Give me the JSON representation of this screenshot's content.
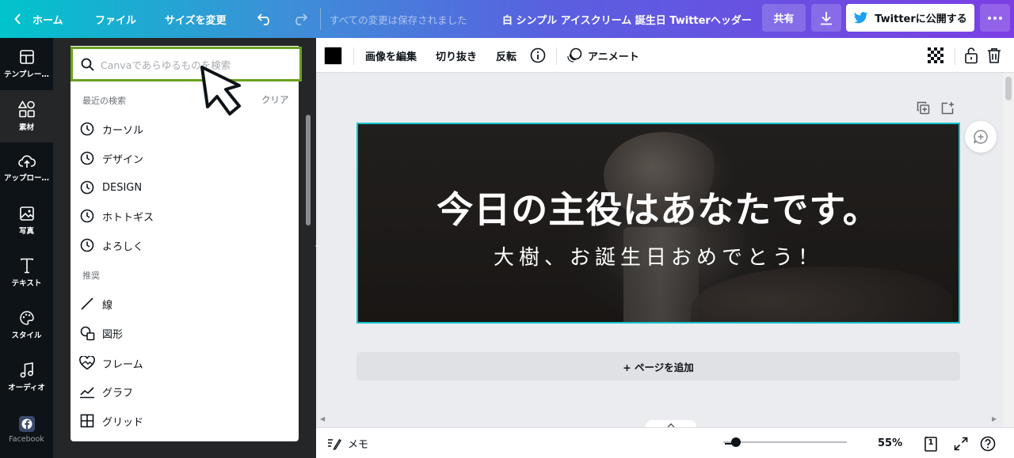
{
  "topbar": {
    "home_label": "ホーム",
    "file_label": "ファイル",
    "resize_label": "サイズを変更",
    "save_status": "すべての変更は保存されました",
    "doc_title": "白 シンプル アイスクリーム 誕生日 Twitterヘッダー",
    "share_label": "共有",
    "publish_label": "Twitterに公開する"
  },
  "rail": {
    "items": [
      {
        "label": "テンプレー…",
        "icon": "template-icon"
      },
      {
        "label": "素材",
        "icon": "elements-icon"
      },
      {
        "label": "アップロー…",
        "icon": "upload-cloud-icon"
      },
      {
        "label": "写真",
        "icon": "photo-icon"
      },
      {
        "label": "テキスト",
        "icon": "text-icon"
      },
      {
        "label": "スタイル",
        "icon": "palette-icon"
      },
      {
        "label": "オーディオ",
        "icon": "music-note-icon"
      },
      {
        "label": "Facebook",
        "icon": "facebook-icon"
      }
    ]
  },
  "search": {
    "placeholder": "Canvaであらゆるものを検索",
    "recent_title": "最近の検索",
    "clear_label": "クリア",
    "recent": [
      "カーソル",
      "デザイン",
      "DESIGN",
      "ホトトギス",
      "よろしく"
    ],
    "recommend_title": "推奨",
    "recommend": [
      {
        "label": "線",
        "icon": "line-icon"
      },
      {
        "label": "図形",
        "icon": "shapes-icon"
      },
      {
        "label": "フレーム",
        "icon": "frame-icon"
      },
      {
        "label": "グラフ",
        "icon": "chart-icon"
      },
      {
        "label": "グリッド",
        "icon": "grid-icon"
      }
    ]
  },
  "edit_toolbar": {
    "edit_image_label": "画像を編集",
    "crop_label": "切り抜き",
    "flip_label": "反転",
    "animate_label": "アニメート",
    "color_swatch": "#000000"
  },
  "design": {
    "title": "今日の主役はあなたです。",
    "subtitle": "大樹、お誕生日おめでとう！"
  },
  "add_page_label": "+ ページを追加",
  "bottombar": {
    "notes_label": "メモ",
    "zoom": "55%",
    "page_count": "1",
    "zoom_fraction": 0.1
  },
  "colors": {
    "accent": "#13c2cb",
    "search_highlight": "#6aa121",
    "publish_icon": "#1da1f2"
  }
}
